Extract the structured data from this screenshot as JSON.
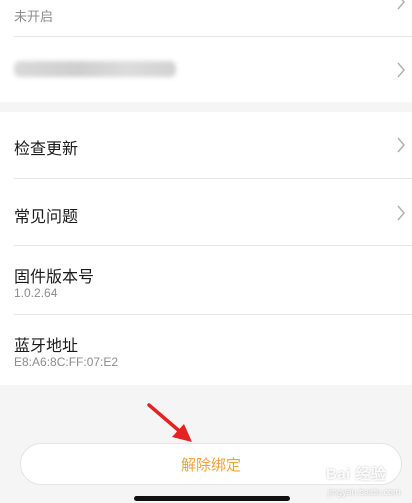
{
  "settings_top": {
    "status_value": "未开启",
    "blurred_item_label": "████████████"
  },
  "settings_list": {
    "check_update": "检查更新",
    "faq": "常见问题",
    "firmware_label": "固件版本号",
    "firmware_value": "1.0.2.64",
    "bluetooth_label": "蓝牙地址",
    "bluetooth_value": "E8:A6:8C:FF:07:E2"
  },
  "actions": {
    "unbind_label": "解除绑定"
  },
  "watermark": {
    "text": "Bai 经验",
    "url": "jingyan.baidu.com"
  },
  "colors": {
    "accent": "#f0a23a",
    "annotation_arrow": "#e52222",
    "background": "#f5f5f5"
  },
  "icons": [
    "chevron-right-icon",
    "red-annotation-arrow",
    "baidu-paw-icon"
  ]
}
